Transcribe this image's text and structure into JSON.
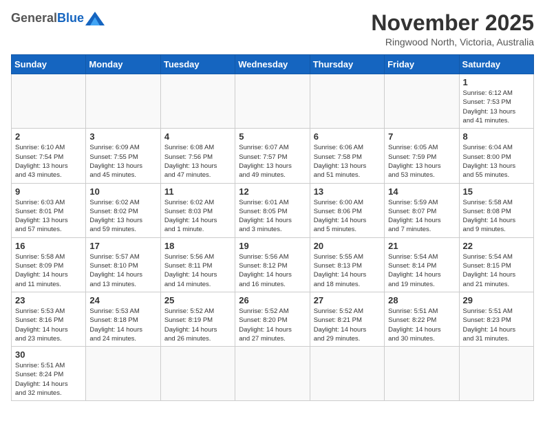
{
  "header": {
    "logo_general": "General",
    "logo_blue": "Blue",
    "month_title": "November 2025",
    "location": "Ringwood North, Victoria, Australia"
  },
  "weekdays": [
    "Sunday",
    "Monday",
    "Tuesday",
    "Wednesday",
    "Thursday",
    "Friday",
    "Saturday"
  ],
  "weeks": [
    [
      {
        "day": "",
        "info": ""
      },
      {
        "day": "",
        "info": ""
      },
      {
        "day": "",
        "info": ""
      },
      {
        "day": "",
        "info": ""
      },
      {
        "day": "",
        "info": ""
      },
      {
        "day": "",
        "info": ""
      },
      {
        "day": "1",
        "info": "Sunrise: 6:12 AM\nSunset: 7:53 PM\nDaylight: 13 hours\nand 41 minutes."
      }
    ],
    [
      {
        "day": "2",
        "info": "Sunrise: 6:10 AM\nSunset: 7:54 PM\nDaylight: 13 hours\nand 43 minutes."
      },
      {
        "day": "3",
        "info": "Sunrise: 6:09 AM\nSunset: 7:55 PM\nDaylight: 13 hours\nand 45 minutes."
      },
      {
        "day": "4",
        "info": "Sunrise: 6:08 AM\nSunset: 7:56 PM\nDaylight: 13 hours\nand 47 minutes."
      },
      {
        "day": "5",
        "info": "Sunrise: 6:07 AM\nSunset: 7:57 PM\nDaylight: 13 hours\nand 49 minutes."
      },
      {
        "day": "6",
        "info": "Sunrise: 6:06 AM\nSunset: 7:58 PM\nDaylight: 13 hours\nand 51 minutes."
      },
      {
        "day": "7",
        "info": "Sunrise: 6:05 AM\nSunset: 7:59 PM\nDaylight: 13 hours\nand 53 minutes."
      },
      {
        "day": "8",
        "info": "Sunrise: 6:04 AM\nSunset: 8:00 PM\nDaylight: 13 hours\nand 55 minutes."
      }
    ],
    [
      {
        "day": "9",
        "info": "Sunrise: 6:03 AM\nSunset: 8:01 PM\nDaylight: 13 hours\nand 57 minutes."
      },
      {
        "day": "10",
        "info": "Sunrise: 6:02 AM\nSunset: 8:02 PM\nDaylight: 13 hours\nand 59 minutes."
      },
      {
        "day": "11",
        "info": "Sunrise: 6:02 AM\nSunset: 8:03 PM\nDaylight: 14 hours\nand 1 minute."
      },
      {
        "day": "12",
        "info": "Sunrise: 6:01 AM\nSunset: 8:05 PM\nDaylight: 14 hours\nand 3 minutes."
      },
      {
        "day": "13",
        "info": "Sunrise: 6:00 AM\nSunset: 8:06 PM\nDaylight: 14 hours\nand 5 minutes."
      },
      {
        "day": "14",
        "info": "Sunrise: 5:59 AM\nSunset: 8:07 PM\nDaylight: 14 hours\nand 7 minutes."
      },
      {
        "day": "15",
        "info": "Sunrise: 5:58 AM\nSunset: 8:08 PM\nDaylight: 14 hours\nand 9 minutes."
      }
    ],
    [
      {
        "day": "16",
        "info": "Sunrise: 5:58 AM\nSunset: 8:09 PM\nDaylight: 14 hours\nand 11 minutes."
      },
      {
        "day": "17",
        "info": "Sunrise: 5:57 AM\nSunset: 8:10 PM\nDaylight: 14 hours\nand 13 minutes."
      },
      {
        "day": "18",
        "info": "Sunrise: 5:56 AM\nSunset: 8:11 PM\nDaylight: 14 hours\nand 14 minutes."
      },
      {
        "day": "19",
        "info": "Sunrise: 5:56 AM\nSunset: 8:12 PM\nDaylight: 14 hours\nand 16 minutes."
      },
      {
        "day": "20",
        "info": "Sunrise: 5:55 AM\nSunset: 8:13 PM\nDaylight: 14 hours\nand 18 minutes."
      },
      {
        "day": "21",
        "info": "Sunrise: 5:54 AM\nSunset: 8:14 PM\nDaylight: 14 hours\nand 19 minutes."
      },
      {
        "day": "22",
        "info": "Sunrise: 5:54 AM\nSunset: 8:15 PM\nDaylight: 14 hours\nand 21 minutes."
      }
    ],
    [
      {
        "day": "23",
        "info": "Sunrise: 5:53 AM\nSunset: 8:16 PM\nDaylight: 14 hours\nand 23 minutes."
      },
      {
        "day": "24",
        "info": "Sunrise: 5:53 AM\nSunset: 8:18 PM\nDaylight: 14 hours\nand 24 minutes."
      },
      {
        "day": "25",
        "info": "Sunrise: 5:52 AM\nSunset: 8:19 PM\nDaylight: 14 hours\nand 26 minutes."
      },
      {
        "day": "26",
        "info": "Sunrise: 5:52 AM\nSunset: 8:20 PM\nDaylight: 14 hours\nand 27 minutes."
      },
      {
        "day": "27",
        "info": "Sunrise: 5:52 AM\nSunset: 8:21 PM\nDaylight: 14 hours\nand 29 minutes."
      },
      {
        "day": "28",
        "info": "Sunrise: 5:51 AM\nSunset: 8:22 PM\nDaylight: 14 hours\nand 30 minutes."
      },
      {
        "day": "29",
        "info": "Sunrise: 5:51 AM\nSunset: 8:23 PM\nDaylight: 14 hours\nand 31 minutes."
      }
    ],
    [
      {
        "day": "30",
        "info": "Sunrise: 5:51 AM\nSunset: 8:24 PM\nDaylight: 14 hours\nand 32 minutes."
      },
      {
        "day": "",
        "info": ""
      },
      {
        "day": "",
        "info": ""
      },
      {
        "day": "",
        "info": ""
      },
      {
        "day": "",
        "info": ""
      },
      {
        "day": "",
        "info": ""
      },
      {
        "day": "",
        "info": ""
      }
    ]
  ]
}
